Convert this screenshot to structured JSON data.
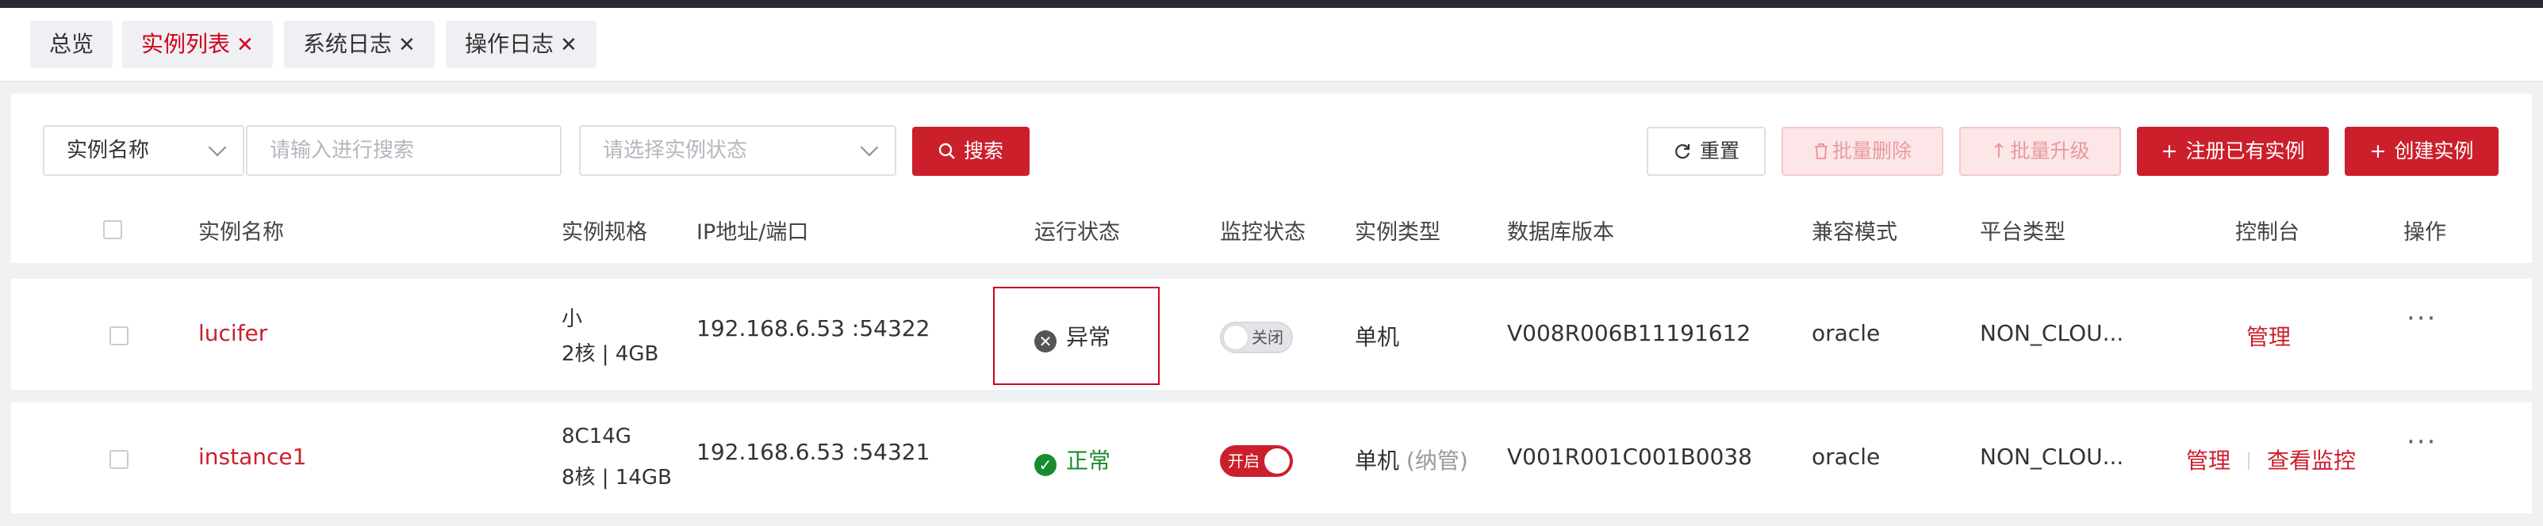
{
  "tabs": [
    {
      "label": "总览",
      "closable": false,
      "active": false
    },
    {
      "label": "实例列表",
      "closable": true,
      "active": true
    },
    {
      "label": "系统日志",
      "closable": true,
      "active": false
    },
    {
      "label": "操作日志",
      "closable": true,
      "active": false
    }
  ],
  "toolbar": {
    "field_select": "实例名称",
    "search_placeholder": "请输入进行搜索",
    "status_placeholder": "请选择实例状态",
    "search_label": "搜索",
    "reset_label": "重置",
    "batch_delete_label": "批量删除",
    "batch_upgrade_label": "批量升级",
    "register_label": "注册已有实例",
    "create_label": "创建实例"
  },
  "table": {
    "columns": [
      "实例名称",
      "实例规格",
      "IP地址/端口",
      "运行状态",
      "监控状态",
      "实例类型",
      "数据库版本",
      "兼容模式",
      "平台类型",
      "控制台",
      "操作"
    ],
    "rows": [
      {
        "name": "lucifer",
        "spec_line1": "小",
        "spec_line2": "2核 | 4GB",
        "ip": "192.168.6.53 :54322",
        "status": "异常",
        "monitor": "关闭",
        "type": "单机",
        "type_note": "",
        "version": "V008R006B11191612",
        "compat": "oracle",
        "platform": "NON_CLOU...",
        "console_links": [
          "管理"
        ],
        "ops": "···"
      },
      {
        "name": "instance1",
        "spec_line1": "8C14G",
        "spec_line2": "8核 | 14GB",
        "ip": "192.168.6.53 :54321",
        "status": "正常",
        "monitor": "开启",
        "type": "单机",
        "type_note": "(纳管)",
        "version": "V001R001C001B0038",
        "compat": "oracle",
        "platform": "NON_CLOU...",
        "console_links": [
          "管理",
          "查看监控"
        ],
        "ops": "···"
      }
    ]
  },
  "colors": {
    "primary": "#cc1f2c",
    "error_icon": "#555555",
    "success": "#1a8a2e"
  }
}
